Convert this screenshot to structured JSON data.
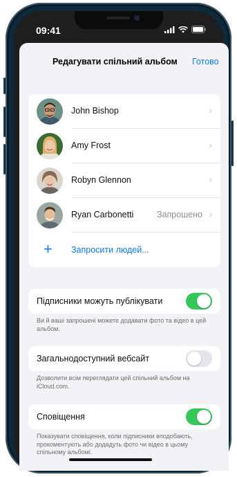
{
  "status_bar": {
    "time": "09:41"
  },
  "nav": {
    "title": "Редагувати спільний альбом",
    "done": "Готово"
  },
  "people": [
    {
      "name": "John Bishop",
      "status": ""
    },
    {
      "name": "Amy Frost",
      "status": ""
    },
    {
      "name": "Robyn Glennon",
      "status": ""
    },
    {
      "name": "Ryan Carbonetti",
      "status": "Запрошено"
    }
  ],
  "invite": {
    "label": "Запросити людей..."
  },
  "settings": {
    "subscribers_post": {
      "label": "Підписники можуть публікувати",
      "enabled": true,
      "footnote": "Ви й ваші запрошені можете додавати фото та відео в цей альбом."
    },
    "public_website": {
      "label": "Загальнодоступний вебсайт",
      "enabled": false,
      "footnote": "Дозволити всім переглядати цей спільний альбом на iCloud.com."
    },
    "notifications": {
      "label": "Сповіщення",
      "enabled": true,
      "footnote": "Показувати сповіщення, коли підписники вподобають, прокоментують або додадуть фото чи відео в цьому спільному альбомі."
    }
  },
  "colors": {
    "accent": "#0a7aff",
    "toggle_on": "#34c759",
    "background": "#f2f2f7"
  },
  "icons": [
    "signal-icon",
    "wifi-icon",
    "battery-icon",
    "chevron-right-icon",
    "plus-icon"
  ]
}
